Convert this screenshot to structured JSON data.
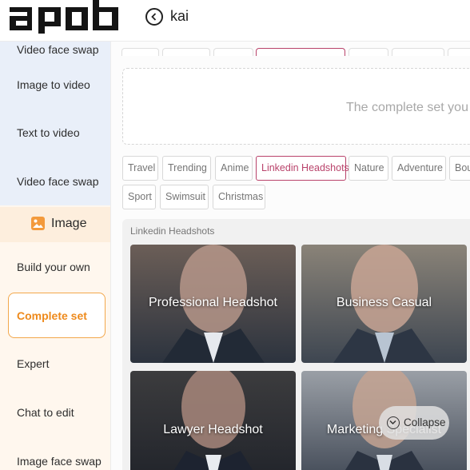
{
  "header": {
    "logo_text": "apob",
    "breadcrumb": "kai"
  },
  "sidebar": {
    "video_items": [
      "Video face swap",
      "Image to video",
      "Text to video",
      "Video face swap"
    ],
    "image_section_label": "Image",
    "image_items": [
      "Build your own",
      "Complete set",
      "Expert",
      "Chat to edit",
      "Image face swap"
    ],
    "active_item": "Complete set"
  },
  "main": {
    "dropzone_text": "The complete set you se",
    "tags_row1": [
      "Travel",
      "Trending",
      "Anime",
      "Linkedin Headshots",
      "Nature",
      "Adventure",
      "Bou"
    ],
    "tags_row2": [
      "Sport",
      "Swimsuit",
      "Christmas"
    ],
    "active_tag": "Linkedin Headshots",
    "panel_title": "Linkedin Headshots",
    "cards": [
      {
        "label": "Professional Headshot"
      },
      {
        "label": "Business Casual"
      },
      {
        "label": "Lawyer Headshot"
      },
      {
        "label": "Marketing Specialist"
      }
    ],
    "collapse_label": "Collapse"
  },
  "colors": {
    "accent_orange": "#f2a74b",
    "active_tag": "#b9436b",
    "sidebar_video_bg": "#e9eff9",
    "sidebar_bg": "#fff7ee"
  }
}
